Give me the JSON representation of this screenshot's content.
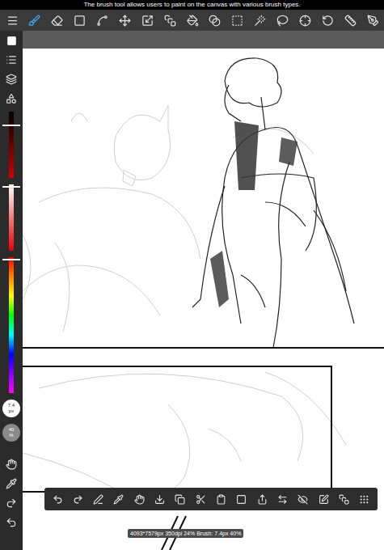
{
  "tooltip": "The brush tool allows users to paint on the canvas with various brush types.",
  "top_toolbar": [
    {
      "selected": true
    },
    {
      "selected": false
    },
    {
      "selected": false
    },
    {
      "selected": false
    },
    {
      "selected": false
    },
    {
      "selected": false
    },
    {
      "selected": false
    },
    {
      "selected": false
    },
    {
      "selected": false
    },
    {
      "selected": false
    },
    {
      "selected": false
    },
    {
      "selected": false
    },
    {
      "selected": false
    },
    {
      "selected": false
    },
    {
      "selected": false
    },
    {
      "selected": false
    }
  ],
  "color_sliders": [
    {
      "kind": "brightness",
      "level": 0.2
    },
    {
      "kind": "saturation",
      "level": 0.03
    },
    {
      "kind": "hue",
      "level": 0.01
    }
  ],
  "brush_size": {
    "value": "7.4",
    "unit": "px"
  },
  "opacity": {
    "value": "40",
    "unit": "%"
  },
  "status_bar": "4093*7579px 350dpi 24% Brush: 7.4px 40%"
}
